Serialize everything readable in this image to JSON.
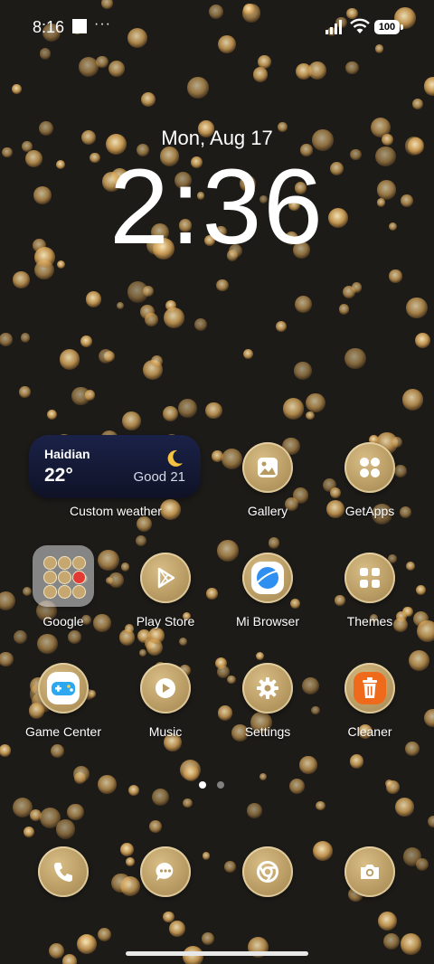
{
  "status_bar": {
    "time": "8:16",
    "more": "···",
    "battery": "100"
  },
  "lock": {
    "date": "Mon, Aug 17",
    "time": "2:36"
  },
  "weather_widget": {
    "city": "Haidian",
    "temperature": "22°",
    "air_quality": "Good 21",
    "label": "Custom weather"
  },
  "apps": {
    "gallery": "Gallery",
    "getapps": "GetApps",
    "google": "Google",
    "play_store": "Play Store",
    "mi_browser": "Mi Browser",
    "themes": "Themes",
    "game_center": "Game Center",
    "music": "Music",
    "settings": "Settings",
    "cleaner": "Cleaner"
  },
  "pager": {
    "pages": 2,
    "current": 1
  },
  "colors": {
    "icon_gold": "#b79a62",
    "widget_navy": "#151a38",
    "cleaner_orange": "#f06a1c",
    "browser_blue": "#2f8ff0"
  }
}
